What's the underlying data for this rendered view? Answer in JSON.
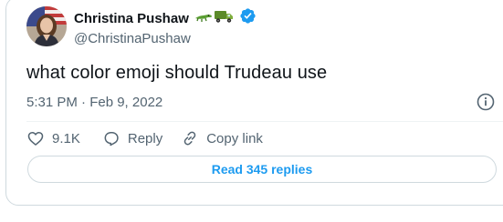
{
  "author": {
    "display_name": "Christina Pushaw",
    "handle": "@ChristinaPushaw",
    "name_emojis": [
      "crocodile-emoji",
      "truck-emoji"
    ],
    "verified_badge": "verified-badge-icon"
  },
  "tweet": {
    "text": "what color emoji should Trudeau use",
    "timestamp": "5:31 PM · Feb 9, 2022"
  },
  "actions": {
    "like_count": "9.1K",
    "reply_label": "Reply",
    "copy_link_label": "Copy link"
  },
  "read_replies_label": "Read 345 replies",
  "colors": {
    "accent": "#1d9bf0",
    "secondary_text": "#536471",
    "border": "#cfd9de"
  }
}
